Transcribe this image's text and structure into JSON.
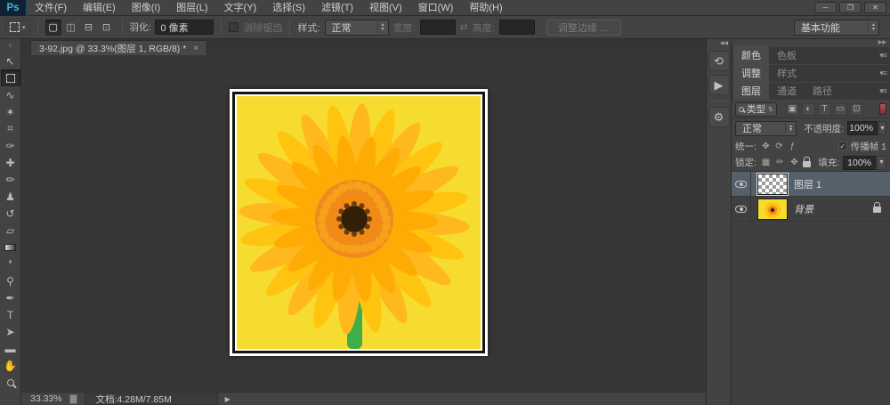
{
  "window": {
    "minimize": "─",
    "restore": "❐",
    "close": "✕"
  },
  "menu_bar": {
    "logo": "Ps",
    "items": [
      "文件(F)",
      "编辑(E)",
      "图像(I)",
      "图层(L)",
      "文字(Y)",
      "选择(S)",
      "滤镜(T)",
      "视图(V)",
      "窗口(W)",
      "帮助(H)"
    ]
  },
  "options_bar": {
    "modes": [
      {
        "name": "new-selection-icon",
        "glyph": "▢",
        "active": true
      },
      {
        "name": "add-to-selection-icon",
        "glyph": "◫",
        "active": false
      },
      {
        "name": "subtract-from-selection-icon",
        "glyph": "⊟",
        "active": false
      },
      {
        "name": "intersect-selection-icon",
        "glyph": "⊡",
        "active": false
      }
    ],
    "feather_label": "羽化:",
    "feather_value": "0 像素",
    "anti_alias_label": "消除锯齿",
    "style_label": "样式:",
    "style_value": "正常",
    "width_label": "宽度:",
    "width_value": "",
    "swap_icon": "⇄",
    "height_label": "高度:",
    "height_value": "",
    "refine_edge_label": "调整边缘 …",
    "workspace": "基本功能"
  },
  "tab_bar": {
    "title": "3-92.jpg @ 33.3%(图层 1, RGB/8) *",
    "close": "×"
  },
  "toolbar": {
    "expand_glyph": "«",
    "tools": [
      {
        "name": "move-tool",
        "glyph": "↖"
      },
      {
        "name": "rectangular-marquee-tool",
        "glyph": "",
        "css": "marquee",
        "active": true
      },
      {
        "name": "lasso-tool",
        "glyph": "∿"
      },
      {
        "name": "quick-selection-tool",
        "glyph": "✶"
      },
      {
        "name": "crop-tool",
        "glyph": "⌗"
      },
      {
        "name": "eyedropper-tool",
        "glyph": "✑"
      },
      {
        "name": "spot-healing-brush-tool",
        "glyph": "✚"
      },
      {
        "name": "brush-tool",
        "glyph": "✏"
      },
      {
        "name": "clone-stamp-tool",
        "glyph": "♟"
      },
      {
        "name": "history-brush-tool",
        "glyph": "↺"
      },
      {
        "name": "eraser-tool",
        "glyph": "▱"
      },
      {
        "name": "gradient-tool",
        "glyph": "",
        "css": "gradient"
      },
      {
        "name": "blur-tool",
        "glyph": "❜"
      },
      {
        "name": "dodge-tool",
        "glyph": "⚲"
      },
      {
        "name": "pen-tool",
        "glyph": "✒"
      },
      {
        "name": "type-tool",
        "glyph": "T"
      },
      {
        "name": "path-selection-tool",
        "glyph": "➤"
      },
      {
        "name": "shape-tool",
        "glyph": "▬"
      },
      {
        "name": "hand-tool",
        "glyph": "✋"
      },
      {
        "name": "zoom-tool",
        "glyph": "",
        "css": "mag"
      }
    ]
  },
  "dock_strip": {
    "expand_glyph": "◀◀",
    "icons": [
      {
        "name": "history-panel-icon",
        "glyph": "⟲"
      },
      {
        "name": "actions-panel-icon",
        "glyph": "▶"
      },
      {
        "name": "properties-panel-icon",
        "glyph": "⚙"
      }
    ]
  },
  "panels": {
    "collapse_glyph": "▶▶",
    "menu_glyph": "▾≡",
    "groups": [
      {
        "tabs": [
          {
            "label": "颜色",
            "active": true
          },
          {
            "label": "色板",
            "active": false
          }
        ]
      },
      {
        "tabs": [
          {
            "label": "调整",
            "active": true
          },
          {
            "label": "样式",
            "active": false
          }
        ]
      },
      {
        "tabs": [
          {
            "label": "图层",
            "active": true
          },
          {
            "label": "通道",
            "active": false
          },
          {
            "label": "路径",
            "active": false
          }
        ]
      }
    ],
    "layers": {
      "search_label": "类型",
      "filter_icons": [
        {
          "name": "filter-pixel-layers-icon",
          "glyph": "▣"
        },
        {
          "name": "filter-adjustment-layers-icon",
          "glyph": "◐"
        },
        {
          "name": "filter-type-layers-icon",
          "glyph": "T"
        },
        {
          "name": "filter-shape-layers-icon",
          "glyph": "▭"
        },
        {
          "name": "filter-smart-objects-icon",
          "glyph": "⊡"
        }
      ],
      "blend_mode": "正常",
      "opacity_label": "不透明度:",
      "opacity_value": "100%",
      "unify_label": "统一:",
      "unify_icons": [
        {
          "name": "unify-position-icon",
          "glyph": "✥"
        },
        {
          "name": "unify-visibility-icon",
          "glyph": "⟳"
        },
        {
          "name": "unify-style-icon",
          "glyph": "ƒ"
        }
      ],
      "propagate_label": "传播帧 1",
      "lock_label": "锁定:",
      "lock_icons": [
        {
          "name": "lock-transparent-pixels-icon",
          "glyph": "▦"
        },
        {
          "name": "lock-image-pixels-icon",
          "glyph": "✏"
        },
        {
          "name": "lock-position-icon",
          "glyph": "✥"
        },
        {
          "name": "lock-all-icon",
          "glyph": "",
          "css": "lock"
        }
      ],
      "fill_label": "填充:",
      "fill_value": "100%",
      "rows": [
        {
          "name": "图层 1",
          "thumb": "checker",
          "selected": true
        },
        {
          "name": "背景",
          "thumb": "flower",
          "locked": true
        }
      ]
    }
  },
  "status_bar": {
    "zoom": "33.33%",
    "doc_label": "文档:4.28M/7.85M",
    "arrow": "▶"
  },
  "canvas_image": {
    "description": "yellow gerbera daisy on yellow background with white matte and black frame",
    "colors": {
      "matte": "#ffffff",
      "frame": "#141414",
      "background": "#f7dc30",
      "petals": "#ffc40f",
      "petals_alt": "#ffb81e",
      "petals_inner": "#ffaa05",
      "disk": "#ef8a1e",
      "disk_dots": "#f9a01b",
      "disk_dots2": "#f28b12",
      "core": "#311f07",
      "core_fringe": "#6b3c0c",
      "stem": "#3fae49"
    }
  }
}
